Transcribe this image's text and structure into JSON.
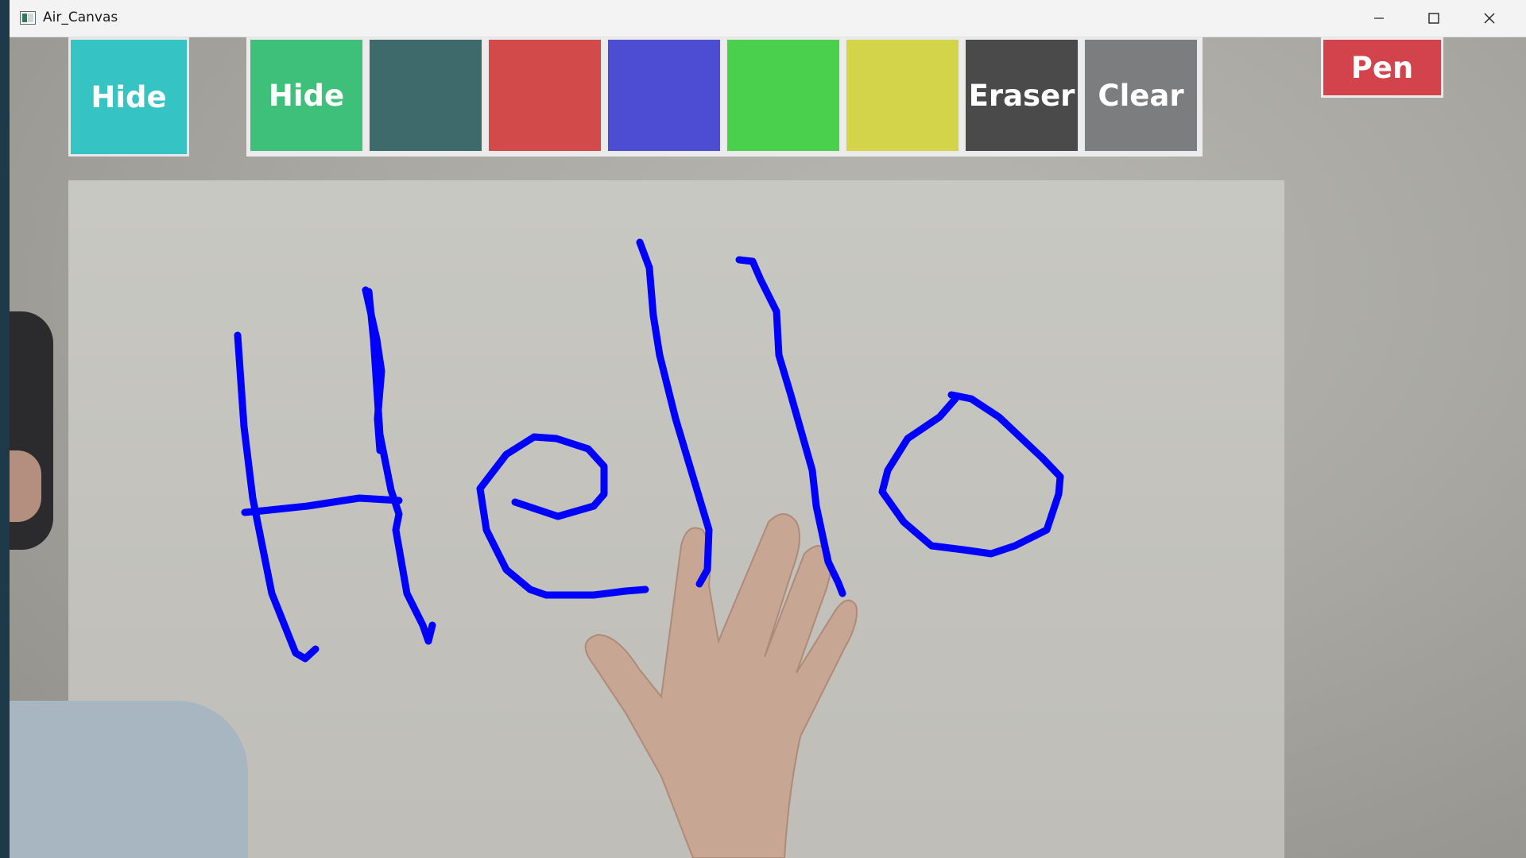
{
  "window": {
    "title": "Air_Canvas",
    "minimize_icon": "minimize-icon",
    "maximize_icon": "maximize-icon",
    "close_icon": "close-icon"
  },
  "toolbar": {
    "hide_label_1": "Hide",
    "hide_label_2": "Hide",
    "eraser_label": "Eraser",
    "clear_label": "Clear",
    "pen_label": "Pen",
    "colors": {
      "hide1": "#35c3c4",
      "hide2": "#3fc07a",
      "slate": "#3f6a6c",
      "red": "#d24a4a",
      "blue": "#4d4dd4",
      "green": "#4ad04d",
      "yellow": "#d4d44a",
      "eraser": "#4a4a4b",
      "clear": "#7c7d7f",
      "pen": "#d2434c"
    }
  },
  "canvas": {
    "drawn_text": "Hello",
    "stroke_color": "#0000ff"
  }
}
